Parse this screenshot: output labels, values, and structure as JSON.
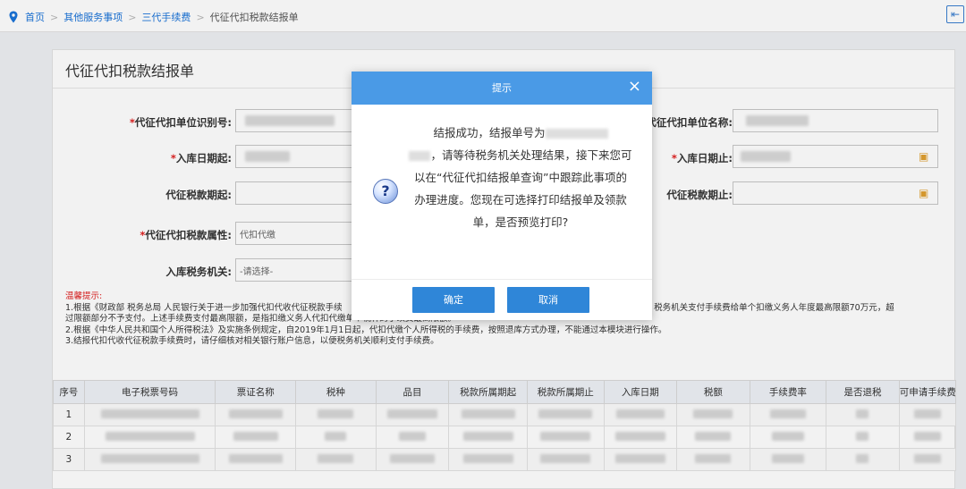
{
  "breadcrumb": {
    "items": [
      "首页",
      "其他服务事项",
      "三代手续费"
    ],
    "current": "代征代扣税款结报单",
    "separator": ">"
  },
  "page": {
    "title": "代征代扣税款结报单"
  },
  "form": {
    "unit_id_label": "代征代扣单位识别号:",
    "unit_name_label": "代征代扣单位名称:",
    "storage_date_start_label": "入库日期起:",
    "storage_date_end_label": "入库日期止:",
    "tax_period_start_label": "代征税款期起:",
    "tax_period_end_label": "代征税款期止:",
    "attribute_label": "代征代扣税款属性:",
    "attribute_value": "代扣代缴",
    "tax_office_label": "入库税务机关:",
    "tax_office_placeholder": "-请选择-",
    "required_mark": "*"
  },
  "tips": {
    "heading": "温馨提示:",
    "line1a": "1.根据《财政部 税务总局 人民银行关于进一步加强代扣代收代征税款手续",
    "line1b": "税款，税务机关支付手续费给单个扣缴义务人年度最高限额70万元，超",
    "line2": "过限额部分不予支付。上述手续费支付最高限额，是指扣缴义务人代扣代缴单个税种的手续费最高限额。",
    "line3": "2.根据《中华人民共和国个人所得税法》及实施条例规定，自2019年1月1日起，代扣代缴个人所得税的手续费，按照退库方式办理，不能通过本模块进行操作。",
    "line4": "3.结报代扣代收代征税款手续费时，请仔细核对相关银行账户信息，以便税务机关顺利支付手续费。"
  },
  "table": {
    "headers": [
      "序号",
      "电子税票号码",
      "票证名称",
      "税种",
      "品目",
      "税款所属期起",
      "税款所属期止",
      "入库日期",
      "税额",
      "手续费率",
      "是否退税",
      "可申请手续费"
    ],
    "rows": [
      "1",
      "2",
      "3"
    ]
  },
  "modal": {
    "title": "提示",
    "close": "×",
    "icon": "question-icon",
    "message_part1": "结报成功，结报单号为",
    "message_part2": "，请等待税务机关处理结果，接下来您可以在“代征代扣结报单查询”中跟踪此事项的办理进度。您现在可选择打印结报单及领款单，是否预览打印?",
    "confirm_label": "确定",
    "cancel_label": "取消"
  },
  "colors": {
    "accent": "#2f86d8",
    "modal_header": "#4a9ae6",
    "required": "#e02020",
    "link": "#1a73d9"
  }
}
